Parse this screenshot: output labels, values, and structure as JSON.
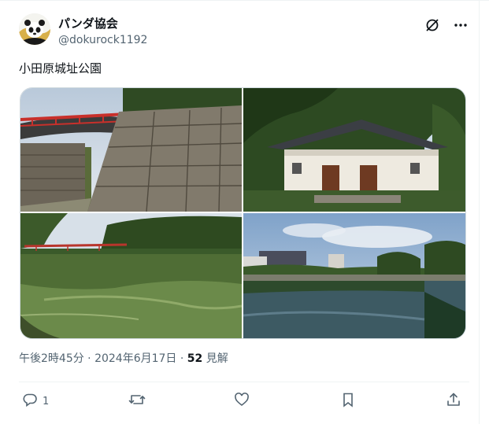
{
  "user": {
    "display_name": "パンダ協会",
    "handle": "@dokurock1192"
  },
  "header_icons": [
    "grok-icon",
    "more-icon"
  ],
  "post": {
    "text": "小田原城址公園"
  },
  "photos": [
    {
      "name": "photo-bridge-and-stone-wall"
    },
    {
      "name": "photo-castle-gate"
    },
    {
      "name": "photo-moat-with-red-bridge"
    },
    {
      "name": "photo-moat-and-buildings"
    }
  ],
  "meta": {
    "datetime": "午後2時45分 · 2024年6月17日 · ",
    "view_count": "52",
    "view_label": " 見解"
  },
  "actions": {
    "reply_count": "1",
    "icons": [
      "reply-icon",
      "repost-icon",
      "like-icon",
      "bookmark-icon",
      "share-icon"
    ]
  },
  "colors": {
    "text": "#0f1419",
    "secondary": "#536471",
    "border": "#cfd9de"
  }
}
